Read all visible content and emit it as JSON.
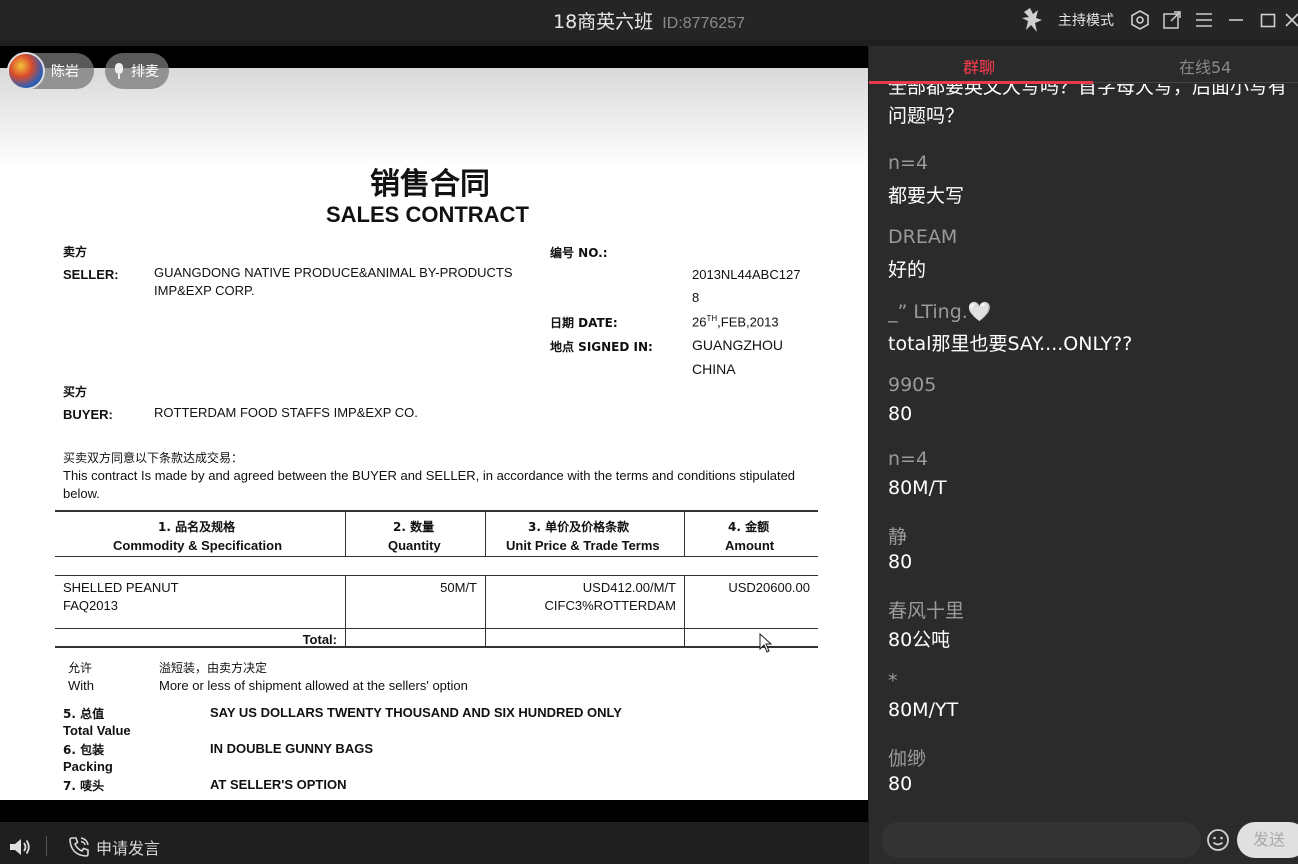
{
  "titlebar": {
    "title": "18商英六班",
    "room_id": "ID:8776257",
    "host_mode": "主持模式"
  },
  "video": {
    "presenter_name": "陈岩",
    "mic_queue_label": "排麦"
  },
  "document": {
    "title_cn": "销售合同",
    "title_en": "SALES CONTRACT",
    "seller_label_cn": "卖方",
    "seller_label": "SELLER:",
    "seller_value_line1": "GUANGDONG NATIVE PRODUCE&ANIMAL BY-PRODUCTS",
    "seller_value_line2": "IMP&EXP CORP.",
    "no_label": "编号 NO.:",
    "no_value_line1": "2013NL44ABC127",
    "no_value_line2": "8",
    "date_label": "日期 DATE:",
    "date_day": "26",
    "date_suffix": "TH",
    "date_rest": ",FEB,2013",
    "signed_label": "地点 SIGNED IN:",
    "signed_value_line1": "GUANGZHOU",
    "signed_value_line2": "CHINA",
    "buyer_label_cn": "买方",
    "buyer_label": "BUYER:",
    "buyer_value": "ROTTERDAM FOOD STAFFS IMP&EXP CO.",
    "intro_cn": "买卖双方同意以下条款达成交易：",
    "intro_en_line1": "This contract Is made by and agreed between the BUYER and SELLER, in accordance with the terms and conditions stipulated",
    "intro_en_line2": "below.",
    "table": {
      "headers": [
        {
          "cn": "1. 品名及规格",
          "en": "Commodity & Specification"
        },
        {
          "cn": "2. 数量",
          "en": "Quantity"
        },
        {
          "cn": "3. 单价及价格条款",
          "en": "Unit Price & Trade Terms"
        },
        {
          "cn": "4. 金额",
          "en": "Amount"
        }
      ],
      "row": {
        "commodity_line1": "SHELLED PEANUT",
        "commodity_line2": "FAQ2013",
        "quantity": "50M/T",
        "unit_price_line1": "USD412.00/M/T",
        "unit_price_line2": "CIFC3%ROTTERDAM",
        "amount": "USD20600.00"
      },
      "total_label": "Total:"
    },
    "allow_cn": "允许",
    "allow_cn_value": "溢短装，由卖方决定",
    "with_label": "With",
    "with_value": "More or less of shipment allowed at the sellers' option",
    "clauses": [
      {
        "num_cn": "5. 总值",
        "en": "Total Value",
        "value": "SAY US DOLLARS TWENTY THOUSAND AND SIX HUNDRED ONLY"
      },
      {
        "num_cn": "6. 包装",
        "en": "Packing",
        "value": "IN DOUBLE GUNNY BAGS"
      },
      {
        "num_cn": "7. 唛头",
        "en": "",
        "value": "AT SELLER'S OPTION"
      }
    ]
  },
  "chat": {
    "tab_group": "群聊",
    "tab_online": "在线54",
    "first_message": "全部都要英文大写吗？首字母大写，后面小写有问题吗？",
    "messages": [
      {
        "name": "n=4",
        "text": "都要大写"
      },
      {
        "name": "DREAM",
        "text": "好的"
      },
      {
        "name": "_” LTing.🤍",
        "text": "total那里也要SAY....ONLY??"
      },
      {
        "name": "9905",
        "text": "80"
      },
      {
        "name": "n=4",
        "text": "80M/T"
      },
      {
        "name": "静",
        "text": "80"
      },
      {
        "name": "春风十里",
        "text": "80公吨"
      },
      {
        "name": " *",
        "text": "80M/YT"
      },
      {
        "name": "伽缈",
        "text": "80"
      }
    ],
    "send_label": "发送"
  },
  "bottombar": {
    "apply_speak": "申请发言"
  }
}
